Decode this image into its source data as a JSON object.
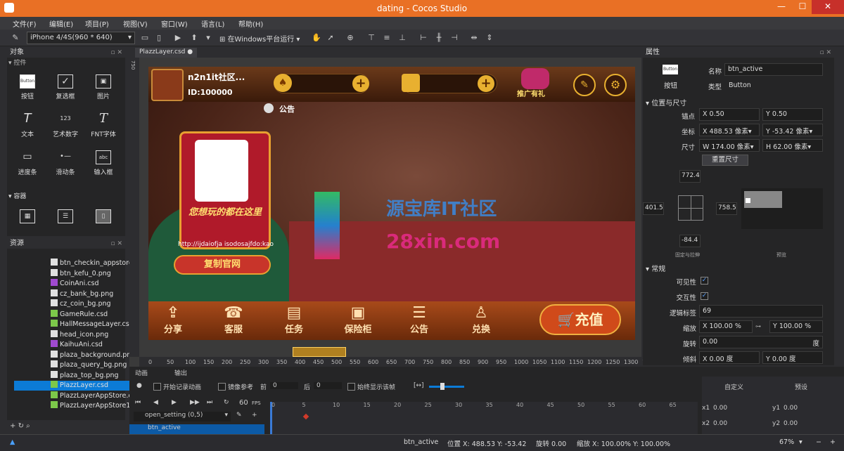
{
  "window": {
    "title": "dating - Cocos Studio",
    "min": "—",
    "max": "☐",
    "close": "✕"
  },
  "menu": [
    "文件(F)",
    "编辑(E)",
    "项目(P)",
    "视图(V)",
    "窗口(W)",
    "语言(L)",
    "帮助(H)"
  ],
  "toolbar": {
    "device": "iPhone 4/4S(960 * 640)",
    "run": "在Windows平台运行"
  },
  "objects": {
    "title": "对象",
    "section_controls": "控件",
    "section_containers": "容器",
    "items": [
      {
        "icon": "Button",
        "label": "按钮"
      },
      {
        "icon": "✓",
        "label": "复选框"
      },
      {
        "icon": "▣",
        "label": "图片"
      },
      {
        "icon": "T",
        "label": "文本"
      },
      {
        "icon": "123",
        "label": "艺术数字"
      },
      {
        "icon": "T",
        "label": "FNT字体"
      },
      {
        "icon": "▭",
        "label": "进度条"
      },
      {
        "icon": "•—",
        "label": "滑动条"
      },
      {
        "icon": "abc",
        "label": "输入框"
      }
    ]
  },
  "resources": {
    "title": "资源",
    "files": [
      {
        "name": "btn_checkin_appstore",
        "type": "png"
      },
      {
        "name": "btn_kefu_0.png",
        "type": "png"
      },
      {
        "name": "CoinAni.csd",
        "type": "csd-anim"
      },
      {
        "name": "cz_bank_bg.png",
        "type": "png"
      },
      {
        "name": "cz_coin_bg.png",
        "type": "png"
      },
      {
        "name": "GameRule.csd",
        "type": "csd"
      },
      {
        "name": "HallMessageLayer.csd",
        "type": "csd"
      },
      {
        "name": "head_icon.png",
        "type": "png"
      },
      {
        "name": "KaihuAni.csd",
        "type": "csd-anim"
      },
      {
        "name": "plaza_background.png",
        "type": "png"
      },
      {
        "name": "plaza_query_bg.png",
        "type": "png"
      },
      {
        "name": "plaza_top_bg.png",
        "type": "png"
      },
      {
        "name": "PlazzLayer.csd",
        "type": "csd"
      },
      {
        "name": "PlazzLayerAppStore.csd",
        "type": "csd"
      },
      {
        "name": "PlazzLayerAppStore1.csd",
        "type": "csd"
      }
    ],
    "selected_index": 12
  },
  "editor": {
    "tab": "PlazzLayer.csd",
    "ruler_x": [
      "0",
      "50",
      "100",
      "150",
      "200",
      "250",
      "300",
      "350",
      "400",
      "450",
      "500",
      "550",
      "600",
      "650",
      "700",
      "750",
      "800",
      "850",
      "900",
      "950",
      "1000",
      "1050",
      "1100",
      "1150",
      "1200",
      "1250",
      "1300",
      "1350"
    ],
    "ruler_y_top": "750"
  },
  "game": {
    "name": "n2n1it社区...",
    "id": "ID:100000",
    "notice": "公告",
    "promo": "推广有礼",
    "poster_title": "您想玩的都在这里",
    "poster_url": "http://ijdaiofja isodosajfdo:kao",
    "copy_btn": "复制官网",
    "watermark1": "源宝库IT社区",
    "watermark2": "28xin.com",
    "bottom": [
      "分享",
      "客服",
      "任务",
      "保险柜",
      "公告",
      "兑换"
    ],
    "recharge": "充值"
  },
  "properties": {
    "title": "属性",
    "widget_icon": "Button",
    "widget_type_label": "按钮",
    "name_label": "名称",
    "name": "btn_active",
    "type_label": "类型",
    "type": "Button",
    "pos_section": "位置与尺寸",
    "anchor_label": "锚点",
    "anchor_x": "0.50",
    "anchor_y": "0.50",
    "coord_label": "坐标",
    "pos_x": "488.53",
    "pos_y": "-53.42",
    "unit": "像素",
    "size_label": "尺寸",
    "w": "174.00",
    "h": "62.00",
    "reset": "重置尺寸",
    "margin_top": "772.4",
    "margin_left": "401.5",
    "margin_right": "758.5",
    "margin_bottom": "-84.4",
    "pin_caption": "固定与拉伸",
    "preview_caption": "预览",
    "general": "常规",
    "visible_label": "可见性",
    "interact_label": "交互性",
    "tag_label": "逻辑标签",
    "tag": "69",
    "scale_label": "缩放",
    "scale_x": "100.00",
    "scale_y": "100.00",
    "pct": "%",
    "rot_label": "旋转",
    "rot": "0.00",
    "deg": "度",
    "skew_label": "倾斜",
    "skew_x": "0.00",
    "skew_y": "0.00"
  },
  "timeline": {
    "tab1": "动画",
    "tab2": "输出",
    "start_rec": "开始记录动画",
    "onion": "镜像参考",
    "before": "前",
    "before_val": "0",
    "after": "后",
    "after_val": "0",
    "frame": "帧",
    "always": "始终显示该帧",
    "fps": "60",
    "fps_unit": "FPS",
    "anim": "open_setting (0,5)",
    "node": "btn_active",
    "ticks": [
      "0",
      "5",
      "10",
      "15",
      "20",
      "25",
      "30",
      "35",
      "40",
      "45",
      "50",
      "55",
      "60",
      "65"
    ],
    "custom": "自定义",
    "preset": "预设",
    "x1": "x1",
    "y1": "y1",
    "x2": "x2",
    "y2": "y2",
    "v": "0.00"
  },
  "status": {
    "name": "btn_active",
    "pos": "位置 X: 488.53   Y: -53.42",
    "rot": "旋转 0.00",
    "scale": "缩放 X: 100.00%  Y: 100.00%",
    "zoom": "67%"
  }
}
